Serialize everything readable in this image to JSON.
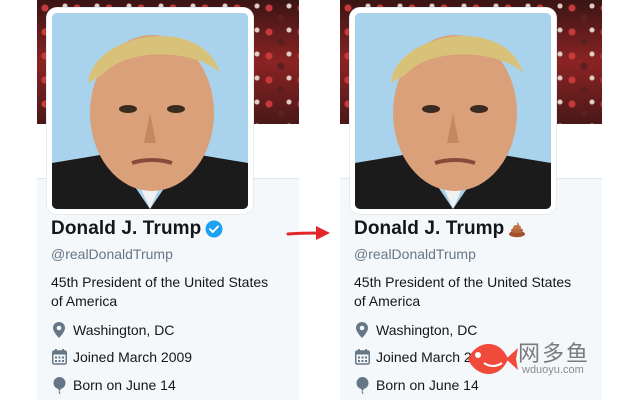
{
  "before": {
    "name": "Donald J. Trump",
    "badge_icon": "verified-badge-icon",
    "handle": "@realDonaldTrump",
    "bio": "45th President of the United States of America",
    "location": "Washington, DC",
    "joined": "Joined March 2009",
    "born": "Born on June 14"
  },
  "after": {
    "name": "Donald J. Trump",
    "badge_icon": "poop-emoji-icon",
    "handle": "@realDonaldTrump",
    "bio": "45th President of the United States of America",
    "location": "Washington, DC",
    "joined": "Joined March 2009",
    "born": "Born on June 14"
  },
  "arrow_color": "#e3262a",
  "accent_color": "#1da1f2",
  "watermark": {
    "cn": "网多鱼",
    "en": "wduoyu.com"
  }
}
